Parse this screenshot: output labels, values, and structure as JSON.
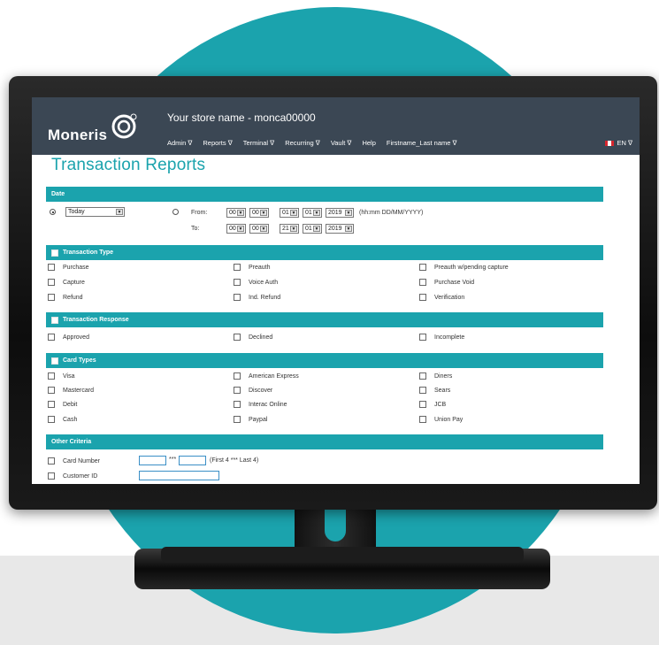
{
  "header": {
    "logo": "Moneris",
    "store_name": "Your store name - monca00000",
    "menu": [
      "Admin ∇",
      "Reports ∇",
      "Terminal ∇",
      "Recurring ∇",
      "Vault ∇",
      "Help",
      "Firstname_Last name ∇"
    ],
    "language": "EN ∇"
  },
  "page_title": "Transaction Reports",
  "date": {
    "heading": "Date",
    "preset": "Today",
    "from_label": "From:",
    "to_label": "To:",
    "from": {
      "hh": "00",
      "mm": "00",
      "dd": "01",
      "mo": "01",
      "yyyy": "2019"
    },
    "to": {
      "hh": "00",
      "mm": "00",
      "dd": "21",
      "mo": "01",
      "yyyy": "2019"
    },
    "format_hint": "(hh:mm DD/MM/YYYY)"
  },
  "transaction_type": {
    "heading": "Transaction Type",
    "options": [
      "Purchase",
      "Preauth",
      "Preauth w/pending capture",
      "Capture",
      "Voice Auth",
      "Purchase Void",
      "Refund",
      "Ind. Refund",
      "Verification"
    ]
  },
  "transaction_response": {
    "heading": "Transaction Response",
    "options": [
      "Approved",
      "Declined",
      "Incomplete"
    ]
  },
  "card_types": {
    "heading": "Card Types",
    "options": [
      "Visa",
      "American Express",
      "Diners",
      "Mastercard",
      "Discover",
      "Sears",
      "Debit",
      "Interac Online",
      "JCB",
      "Cash",
      "Paypal",
      "Union Pay"
    ]
  },
  "other_criteria": {
    "heading": "Other Criteria",
    "card_number_label": "Card Number",
    "card_mask_separator": "***",
    "card_hint": "(First 4 *** Last 4)",
    "customer_id_label": "Customer ID"
  },
  "colors": {
    "accent": "#1ba3ad",
    "nav": "#3b4754"
  }
}
